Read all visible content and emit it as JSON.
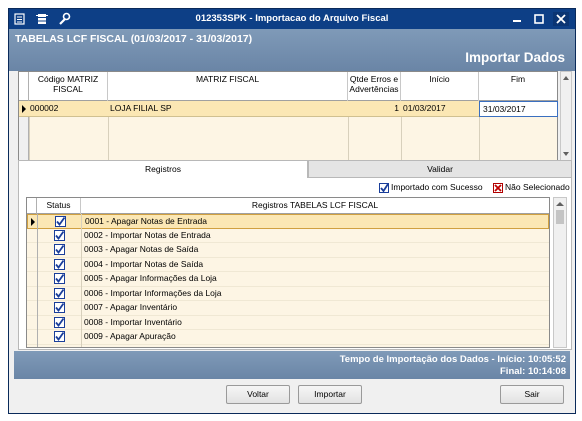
{
  "window": {
    "title": "012353SPK - Importacao do Arquivo Fiscal",
    "titlebar_icons": [
      "app-menu-icon",
      "status-icon",
      "tools-icon"
    ],
    "controls": [
      "minimize",
      "maximize",
      "close"
    ],
    "colors": {
      "titlebar": "#0d3f86",
      "header_bar": "#7591b1",
      "selected_row": "#fbe7b4",
      "grid_bg": "#fdf5e4"
    }
  },
  "header": {
    "left_title": "TABELAS LCF FISCAL (01/03/2017 - 31/03/2017)",
    "right_title": "Importar Dados"
  },
  "matrix_grid": {
    "columns": [
      "Código MATRIZ FISCAL",
      "MATRIZ FISCAL",
      "Qtde Erros e Advertências",
      "Início",
      "Fim"
    ],
    "rows": [
      {
        "codigo": "000002",
        "matriz": "LOJA FILIAL SP",
        "qtde": "1",
        "inicio": "01/03/2017",
        "fim": "31/03/2017"
      }
    ]
  },
  "tabs": [
    {
      "label": "Registros",
      "active": true
    },
    {
      "label": "Validar",
      "active": false
    }
  ],
  "legend": {
    "imported": "Importado com Sucesso",
    "not_selected": "Não Selecionado"
  },
  "records_grid": {
    "columns": [
      "Status",
      "Registros TABELAS LCF FISCAL"
    ],
    "rows": [
      {
        "checked": true,
        "label": "0001 - Apagar Notas de Entrada"
      },
      {
        "checked": true,
        "label": "0002 - Importar Notas de Entrada"
      },
      {
        "checked": true,
        "label": "0003 - Apagar Notas de Saída"
      },
      {
        "checked": true,
        "label": "0004 - Importar Notas de Saída"
      },
      {
        "checked": true,
        "label": "0005 - Apagar Informações da Loja"
      },
      {
        "checked": true,
        "label": "0006 - Importar Informações da Loja"
      },
      {
        "checked": true,
        "label": "0007 - Apagar Inventário"
      },
      {
        "checked": true,
        "label": "0008 - Importar Inventário"
      },
      {
        "checked": true,
        "label": "0009 - Apagar Apuração"
      }
    ]
  },
  "status_bar": {
    "line1": "Tempo de Importação dos Dados - Início: 10:05:52",
    "line2": "Final: 10:14:08"
  },
  "buttons": {
    "voltar": "Voltar",
    "importar": "Importar",
    "sair": "Sair"
  }
}
